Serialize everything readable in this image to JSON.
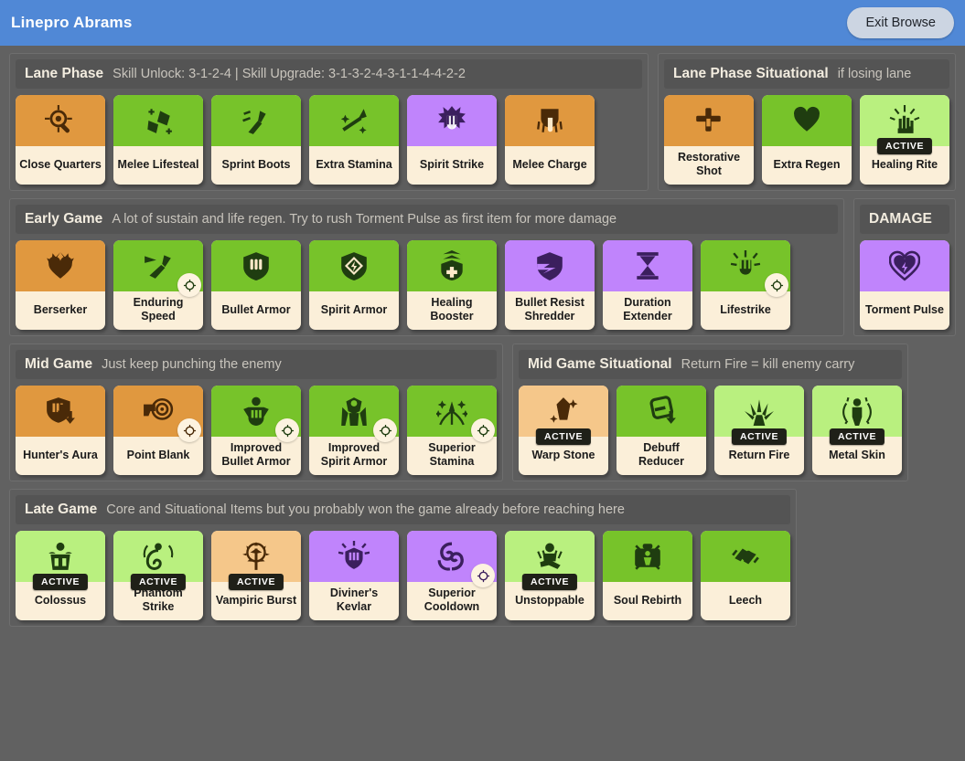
{
  "titlebar": {
    "title": "Linepro Abrams",
    "exit_label": "Exit Browse",
    "bar_color": "#5088d6",
    "button_color": "#ccd5e2"
  },
  "palette": {
    "page_bg": "#616161",
    "panel_bg": "#5d5d5d",
    "header_bg": "#545454",
    "card_label_bg": "#fbefd9",
    "orange": "#e0983f",
    "orange_light": "#f5c78a",
    "green": "#77c32a",
    "green_light": "#b9f07f",
    "purple": "#c084fc",
    "icon_dark_green": "#1f3d10",
    "icon_dark_orange": "#4a2a08",
    "icon_dark_purple": "#3b1f5e",
    "active_badge_bg": "#1f2018"
  },
  "sections": [
    {
      "id": "lane-phase",
      "title": "Lane Phase",
      "note": "Skill Unlock: 3-1-2-4 | Skill Upgrade: 3-1-3-2-4-3-1-1-4-4-2-2",
      "items": [
        {
          "name": "Close Quarters",
          "tier": "orange",
          "icon": "target-magnifier-icon",
          "active": false,
          "upgrade": false
        },
        {
          "name": "Melee Lifesteal",
          "tier": "green",
          "icon": "gauntlet-fist-icon",
          "active": false,
          "upgrade": false
        },
        {
          "name": "Sprint Boots",
          "tier": "green",
          "icon": "boot-speed-icon",
          "active": false,
          "upgrade": false
        },
        {
          "name": "Extra Stamina",
          "tier": "green",
          "icon": "dash-sparkle-icon",
          "active": false,
          "upgrade": false
        },
        {
          "name": "Spirit Strike",
          "tier": "purple",
          "icon": "fist-burst-icon",
          "active": false,
          "upgrade": false
        },
        {
          "name": "Melee Charge",
          "tier": "orange",
          "icon": "fist-charge-icon",
          "active": false,
          "upgrade": false
        }
      ]
    },
    {
      "id": "lane-phase-situational",
      "title": "Lane Phase Situational",
      "note": "if losing lane",
      "items": [
        {
          "name": "Restorative Shot",
          "tier": "orange",
          "icon": "syringe-cross-icon",
          "active": false,
          "upgrade": false
        },
        {
          "name": "Extra Regen",
          "tier": "green",
          "icon": "heart-bar-icon",
          "active": false,
          "upgrade": false
        },
        {
          "name": "Healing Rite",
          "tier": "green_light",
          "icon": "healing-hand-icon",
          "active": true,
          "upgrade": false
        }
      ]
    },
    {
      "id": "early-game",
      "title": "Early Game",
      "note": "A lot of sustain and life regen. Try to rush Torment Pulse as first item for more damage",
      "items": [
        {
          "name": "Berserker",
          "tier": "orange",
          "icon": "heart-spike-icon",
          "active": false,
          "upgrade": false
        },
        {
          "name": "Enduring Speed",
          "tier": "green",
          "icon": "winged-boot-icon",
          "active": false,
          "upgrade": true
        },
        {
          "name": "Bullet Armor",
          "tier": "green",
          "icon": "shield-bullets-icon",
          "active": false,
          "upgrade": false
        },
        {
          "name": "Spirit Armor",
          "tier": "green",
          "icon": "shield-spirit-icon",
          "active": false,
          "upgrade": false
        },
        {
          "name": "Healing Booster",
          "tier": "green",
          "icon": "shield-medkit-icon",
          "active": false,
          "upgrade": false
        },
        {
          "name": "Bullet Resist Shredder",
          "tier": "purple",
          "icon": "shield-break-icon",
          "active": false,
          "upgrade": false
        },
        {
          "name": "Duration Extender",
          "tier": "purple",
          "icon": "hourglass-icon",
          "active": false,
          "upgrade": false
        },
        {
          "name": "Lifestrike",
          "tier": "green",
          "icon": "fist-impact-icon",
          "active": false,
          "upgrade": true
        }
      ]
    },
    {
      "id": "damage",
      "title": "DAMAGE",
      "note": "",
      "items": [
        {
          "name": "Torment Pulse",
          "tier": "purple",
          "icon": "heart-pulse-icon",
          "active": false,
          "upgrade": false
        }
      ]
    },
    {
      "id": "mid-game",
      "title": "Mid Game",
      "note": "Just keep punching the enemy",
      "items": [
        {
          "name": "Hunter's Aura",
          "tier": "orange",
          "icon": "shield-arrow-down-icon",
          "active": false,
          "upgrade": false
        },
        {
          "name": "Point Blank",
          "tier": "orange",
          "icon": "gun-target-icon",
          "active": false,
          "upgrade": true
        },
        {
          "name": "Improved Bullet Armor",
          "tier": "green",
          "icon": "armored-torso-icon",
          "active": false,
          "upgrade": true
        },
        {
          "name": "Improved Spirit Armor",
          "tier": "green",
          "icon": "spirit-robe-icon",
          "active": false,
          "upgrade": true
        },
        {
          "name": "Superior Stamina",
          "tier": "green",
          "icon": "stamina-burst-icon",
          "active": false,
          "upgrade": true
        }
      ]
    },
    {
      "id": "mid-game-situational",
      "title": "Mid Game Situational",
      "note": "Return Fire = kill enemy carry",
      "items": [
        {
          "name": "Warp Stone",
          "tier": "orange_light",
          "icon": "crystal-sparkle-icon",
          "active": true,
          "upgrade": false
        },
        {
          "name": "Debuff Reducer",
          "tier": "green",
          "icon": "minus-shield-icon",
          "active": false,
          "upgrade": false
        },
        {
          "name": "Return Fire",
          "tier": "green_light",
          "icon": "burst-arrows-icon",
          "active": true,
          "upgrade": false
        },
        {
          "name": "Metal Skin",
          "tier": "green_light",
          "icon": "body-aura-icon",
          "active": true,
          "upgrade": false
        }
      ]
    },
    {
      "id": "late-game",
      "title": "Late Game",
      "note": "Core and Situational Items but you probably won the game already before reaching here",
      "items": [
        {
          "name": "Colossus",
          "tier": "green_light",
          "icon": "giant-figure-icon",
          "active": true,
          "upgrade": false
        },
        {
          "name": "Phantom Strike",
          "tier": "green_light",
          "icon": "spiral-phantom-icon",
          "active": true,
          "upgrade": false
        },
        {
          "name": "Vampiric Burst",
          "tier": "orange_light",
          "icon": "vampire-crown-icon",
          "active": true,
          "upgrade": false
        },
        {
          "name": "Diviner's Kevlar",
          "tier": "purple",
          "icon": "radiant-shield-icon",
          "active": false,
          "upgrade": false
        },
        {
          "name": "Superior Cooldown",
          "tier": "purple",
          "icon": "swirl-cooldown-icon",
          "active": false,
          "upgrade": true
        },
        {
          "name": "Unstoppable",
          "tier": "green_light",
          "icon": "crouch-figure-icon",
          "active": true,
          "upgrade": false
        },
        {
          "name": "Soul Rebirth",
          "tier": "green",
          "icon": "medkit-soul-icon",
          "active": false,
          "upgrade": false
        },
        {
          "name": "Leech",
          "tier": "green",
          "icon": "hands-heart-icon",
          "active": false,
          "upgrade": false
        }
      ]
    }
  ],
  "layout": {
    "rows": [
      {
        "panels": [
          {
            "section": 0,
            "grow": true
          },
          {
            "section": 1,
            "grow": false
          }
        ]
      },
      {
        "panels": [
          {
            "section": 2,
            "grow": true
          },
          {
            "section": 3,
            "grow": false
          }
        ]
      },
      {
        "panels": [
          {
            "section": 4,
            "grow": false
          },
          {
            "section": 5,
            "grow": false
          }
        ]
      },
      {
        "panels": [
          {
            "section": 6,
            "grow": false
          }
        ]
      }
    ]
  }
}
